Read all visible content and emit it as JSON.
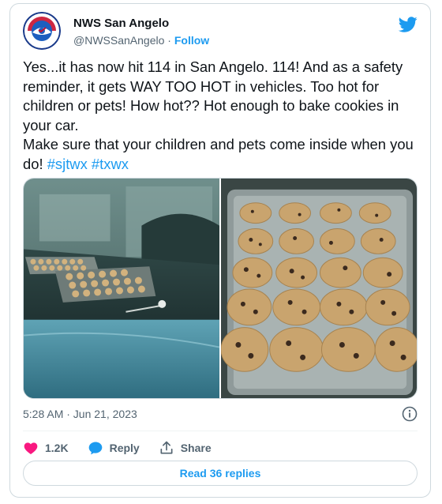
{
  "author": {
    "name": "NWS San Angelo",
    "handle": "@NWSSanAngelo",
    "separator": "·",
    "follow_label": "Follow"
  },
  "tweet": {
    "line1": "Yes...it has now hit 114 in San Angelo. 114! And as a safety reminder, it gets WAY TOO HOT in vehicles. Too hot for children or pets! How hot?? Hot enough to bake cookies in your car.",
    "line2": "Make sure that your children and pets come inside when you do! ",
    "hashtags": [
      "#sjtwx",
      "#txwx"
    ]
  },
  "media": {
    "photo1_icon": "cookies-on-car-dashboard",
    "photo2_icon": "baked-cookies-on-tray"
  },
  "meta": {
    "timestamp": "5:28 AM · Jun 21, 2023"
  },
  "actions": {
    "like_count": "1.2K",
    "reply_label": "Reply",
    "share_label": "Share"
  },
  "read_replies_label": "Read 36 replies",
  "colors": {
    "accent": "#1d9bf0",
    "like": "#f91880",
    "muted": "#536471"
  }
}
